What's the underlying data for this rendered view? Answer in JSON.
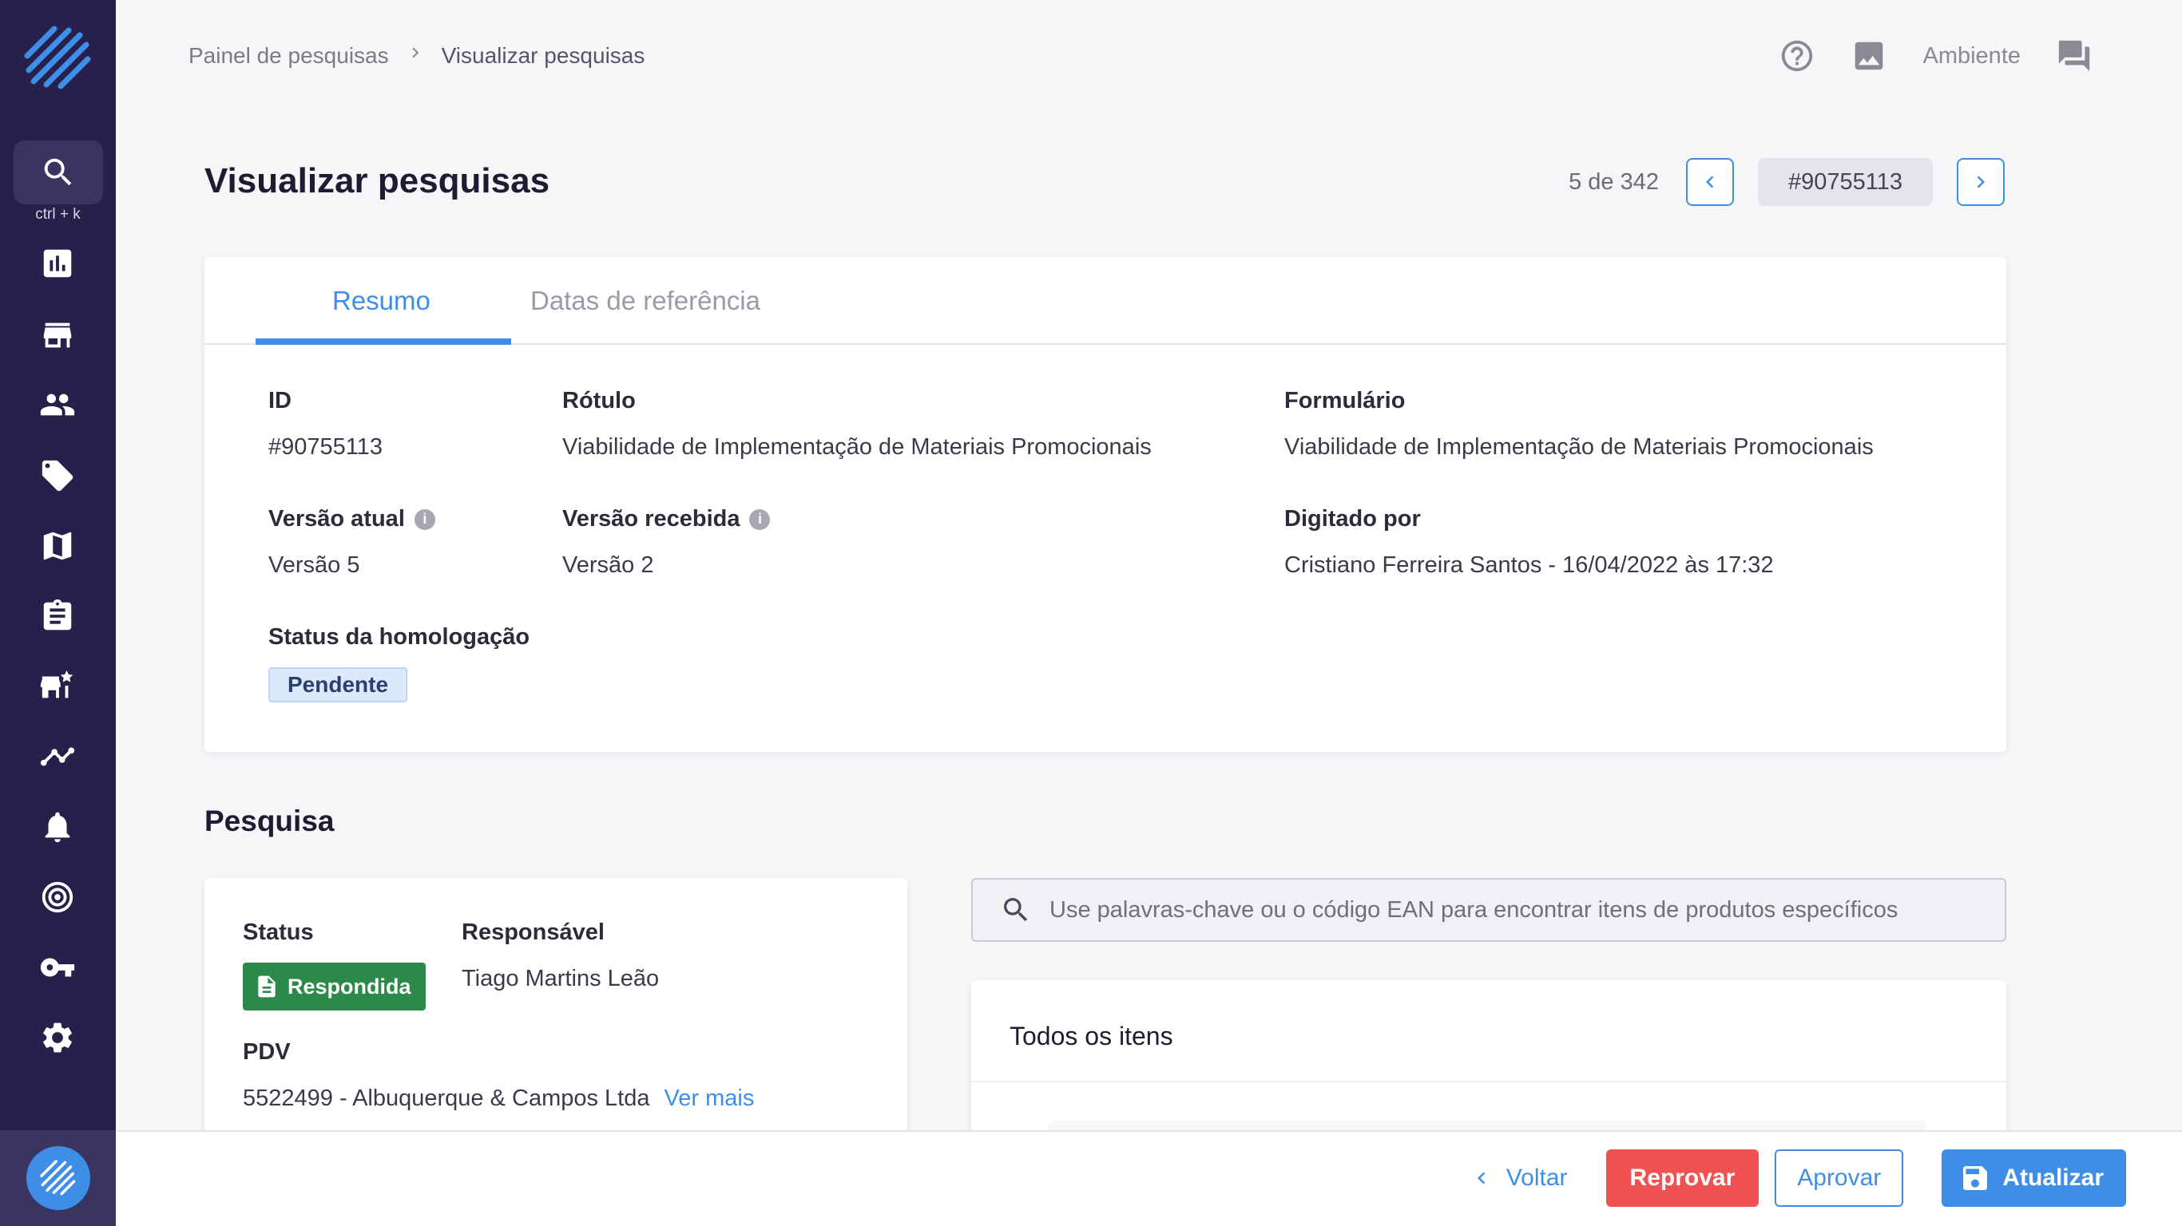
{
  "sidebar": {
    "search_hint": "ctrl + k",
    "icons": [
      "chart-icon",
      "store-icon",
      "people-icon",
      "tag-icon",
      "map-icon",
      "clipboard-icon",
      "store-star-icon",
      "trend-icon",
      "bell-icon",
      "target-icon",
      "key-icon",
      "gear-icon"
    ]
  },
  "breadcrumb": {
    "items": [
      "Painel de pesquisas",
      "Visualizar pesquisas"
    ],
    "separator": ">"
  },
  "topbar": {
    "environment_label": "Ambiente"
  },
  "page": {
    "title": "Visualizar pesquisas",
    "pager": {
      "count": "5 de 342",
      "current_id": "#90755113"
    }
  },
  "summary": {
    "tabs": [
      {
        "label": "Resumo",
        "active": true
      },
      {
        "label": "Datas de referência",
        "active": false
      }
    ],
    "fields": {
      "id": {
        "label": "ID",
        "value": "#90755113"
      },
      "rotulo": {
        "label": "Rótulo",
        "value": "Viabilidade de Implementação de Materiais Promocionais"
      },
      "formulario": {
        "label": "Formulário",
        "value": "Viabilidade de Implementação de Materiais Promocionais"
      },
      "versao_atual": {
        "label": "Versão atual",
        "value": "Versão 5"
      },
      "versao_recebida": {
        "label": "Versão recebida",
        "value": "Versão 2"
      },
      "digitado_por": {
        "label": "Digitado por",
        "value": "Cristiano Ferreira Santos - 16/04/2022 às 17:32"
      },
      "status_homologacao": {
        "label": "Status da homologação",
        "value": "Pendente"
      }
    },
    "info_glyph": "i"
  },
  "pesquisa": {
    "section_title": "Pesquisa",
    "status": {
      "label": "Status",
      "value": "Respondida"
    },
    "responsavel": {
      "label": "Responsável",
      "value": "Tiago Martins Leão"
    },
    "pdv": {
      "label": "PDV",
      "value": "5522499 - Albuquerque & Campos Ltda",
      "link": "Ver mais"
    },
    "search_placeholder": "Use palavras-chave ou o código EAN para encontrar itens de produtos específicos",
    "items_title": "Todos os itens"
  },
  "footer": {
    "back": "Voltar",
    "reject": "Reprovar",
    "approve": "Aprovar",
    "update": "Atualizar"
  },
  "colors": {
    "sidebar": "#26204a",
    "accent": "#3e8ee8",
    "reject": "#f05252",
    "answered": "#2b8a4a",
    "pending_bg": "#dce9fb"
  }
}
